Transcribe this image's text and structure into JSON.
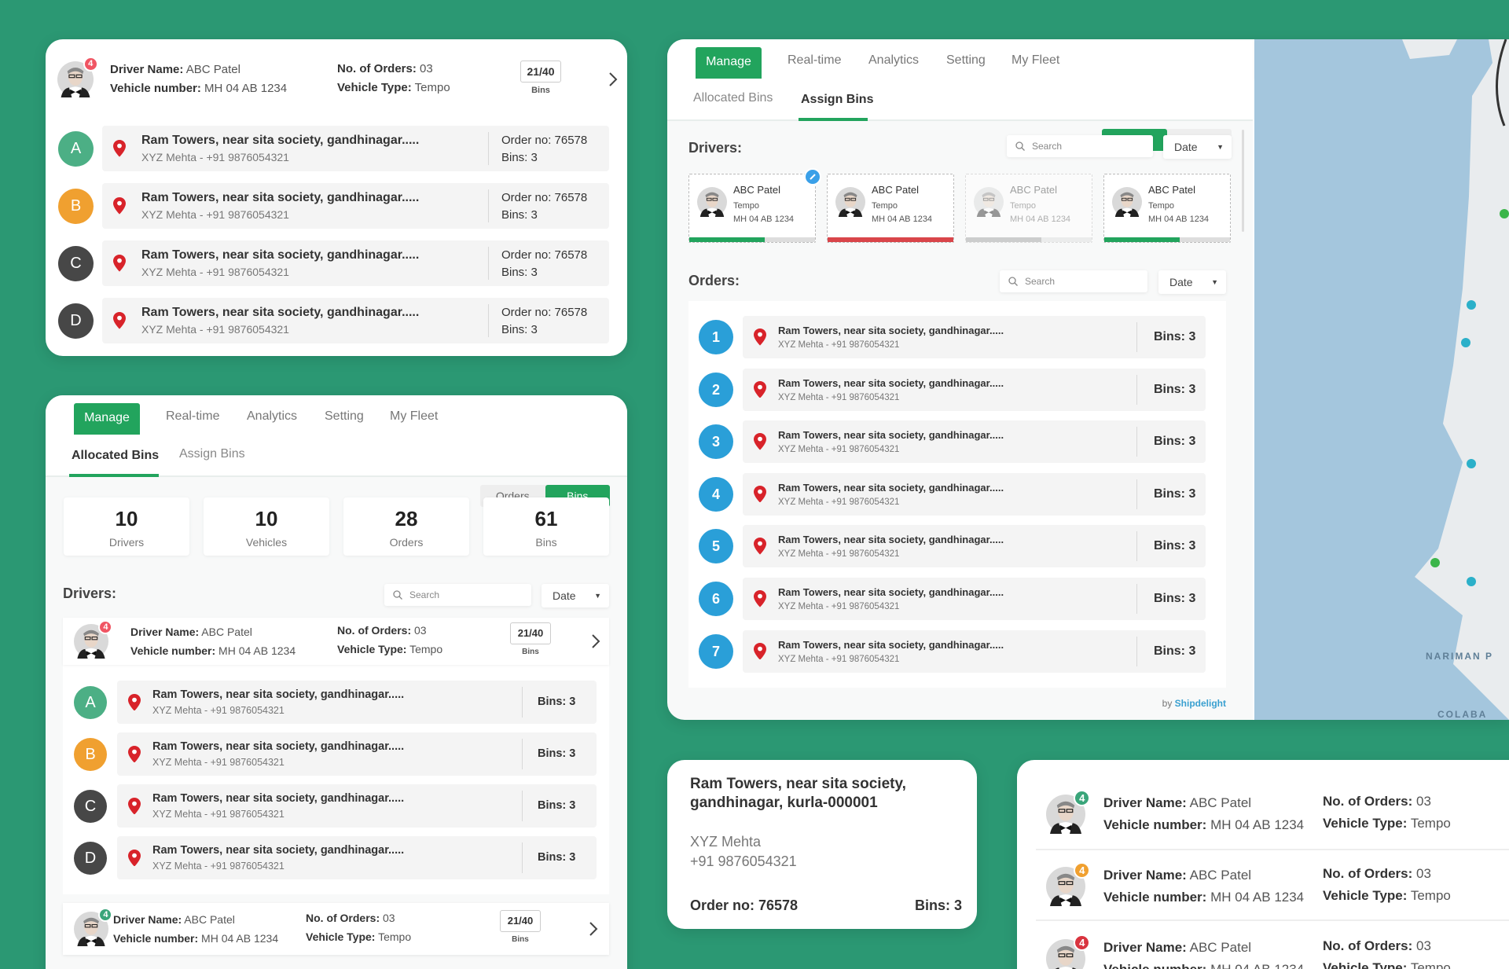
{
  "colors": {
    "background": "#2b9873",
    "accent_green": "#22a45d",
    "order_blue": "#2a9fd8",
    "pin_red": "#d8232a",
    "map_water": "#a4c6dd",
    "map_land": "#e9ecee"
  },
  "nav": {
    "tabs": [
      "Manage",
      "Real-time",
      "Analytics",
      "Setting",
      "My Fleet"
    ],
    "subtabs": [
      "Allocated Bins",
      "Assign Bins"
    ],
    "toggle": [
      "Orders",
      "Bins"
    ]
  },
  "driver": {
    "name_label": "Driver Name:",
    "name": "ABC Patel",
    "vehicle_label": "Vehicle number:",
    "vehicle": "MH 04 AB 1234",
    "orders_label": "No. of Orders:",
    "orders": "03",
    "type_label": "Vehicle Type:",
    "type": "Tempo",
    "bins": "21/40",
    "bins_label": "Bins"
  },
  "stop": {
    "address": "Ram Towers, near sita society, gandhinagar.....",
    "contact": "XYZ Mehta - +91 9876054321",
    "order": "Order no: 76578",
    "bins": "Bins: 3"
  },
  "card1": {
    "badge": "4",
    "badge_color": "#f05563",
    "stops": [
      {
        "letter": "A",
        "color": "#4caf85"
      },
      {
        "letter": "B",
        "color": "#f0a030"
      },
      {
        "letter": "C",
        "color": "#474747"
      },
      {
        "letter": "D",
        "color": "#474747"
      }
    ]
  },
  "card2": {
    "active_subtab": 0,
    "active_toggle": 1,
    "stats": [
      {
        "value": "10",
        "label": "Drivers"
      },
      {
        "value": "10",
        "label": "Vehicles"
      },
      {
        "value": "28",
        "label": "Orders"
      },
      {
        "value": "61",
        "label": "Bins"
      }
    ],
    "drivers_label": "Drivers:",
    "search_placeholder": "Search",
    "date_label": "Date",
    "drivers": [
      {
        "badge": "4",
        "badge_color": "#f05563"
      },
      {
        "badge": "4",
        "badge_color": "#3aa57a"
      }
    ],
    "stops": [
      {
        "letter": "A",
        "color": "#4caf85"
      },
      {
        "letter": "B",
        "color": "#f0a030"
      },
      {
        "letter": "C",
        "color": "#474747"
      },
      {
        "letter": "D",
        "color": "#474747"
      }
    ]
  },
  "card3": {
    "active_subtab": 1,
    "active_toggle": 0,
    "drivers_label": "Drivers:",
    "orders_label": "Orders:",
    "search_placeholder": "Search",
    "date_label": "Date",
    "driver_cards": [
      {
        "name": "ABC Patel",
        "type": "Tempo",
        "vehicle": "MH 04 AB 1234",
        "progress": 0.6,
        "bar_color": "#22a45d",
        "selected": true,
        "faded": false
      },
      {
        "name": "ABC Patel",
        "type": "Tempo",
        "vehicle": "MH 04 AB 1234",
        "progress": 1.0,
        "bar_color": "#d9454a",
        "selected": false,
        "faded": false
      },
      {
        "name": "ABC Patel",
        "type": "Tempo",
        "vehicle": "MH 04 AB 1234",
        "progress": 0.6,
        "bar_color": "#999999",
        "selected": false,
        "faded": true
      },
      {
        "name": "ABC Patel",
        "type": "Tempo",
        "vehicle": "MH 04 AB 1234",
        "progress": 0.6,
        "bar_color": "#22a45d",
        "selected": false,
        "faded": false
      }
    ],
    "orders": [
      "1",
      "2",
      "3",
      "4",
      "5",
      "6",
      "7"
    ],
    "footer_by": "by",
    "footer_brand": "Shipdelight"
  },
  "map": {
    "labels": [
      "NARIMAN P",
      "COLABA"
    ]
  },
  "card4": {
    "address_line1": "Ram Towers, near sita society,",
    "address_line2": "gandhinagar, kurla-000001",
    "contact_name": "XYZ Mehta",
    "contact_phone": "+91 9876054321",
    "order": "Order no: 76578",
    "bins": "Bins: 3"
  },
  "card5": {
    "drivers": [
      {
        "badge": "4",
        "badge_color": "#3aa57a"
      },
      {
        "badge": "4",
        "badge_color": "#f0a030"
      },
      {
        "badge": "4",
        "badge_color": "#d9343f"
      }
    ]
  }
}
